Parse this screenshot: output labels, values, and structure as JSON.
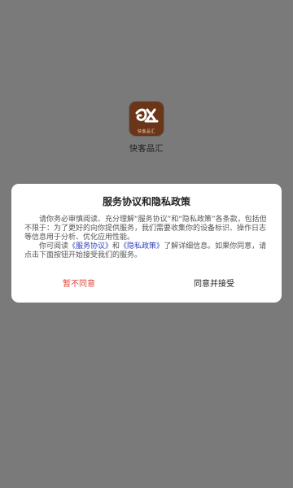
{
  "app": {
    "name": "快客品汇",
    "logo_caption": "快客品汇"
  },
  "dialog": {
    "title": "服务协议和隐私政策",
    "paragraph1": "请你务必审慎阅读、充分理解“服务协议”和“隐私政策”各条款，包括但不限于：为了更好的向你提供服务，我们需要收集你的设备标识、操作日志等信息用于分析、优化应用性能。",
    "paragraph2_prefix": "你可阅读",
    "link_service": "《服务协议》",
    "paragraph2_and": "和",
    "link_privacy": "《隐私政策》",
    "paragraph2_suffix": "了解详细信息。如果你同意，请点击下面按钮开始接受我们的服务。",
    "decline_label": "暂不同意",
    "accept_label": "同意并接受"
  },
  "colors": {
    "overlay": "#7a7a7a",
    "link": "#2e3fbf",
    "decline": "#e0443a"
  }
}
